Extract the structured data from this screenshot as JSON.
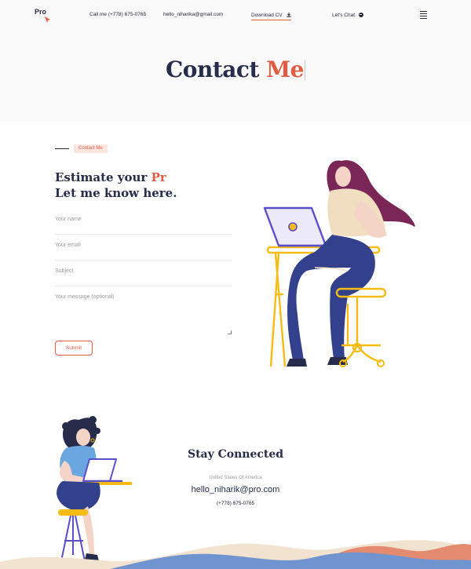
{
  "header": {
    "logo": "Pro",
    "phone": "Call me (+778) 675-0765",
    "email": "hello_niharika@gmail.com",
    "download_cv": "Download CV",
    "lets_chat": "Let's Chat"
  },
  "hero": {
    "title_main": "Contact",
    "title_accent": "Me"
  },
  "contact": {
    "eyebrow": "Contact Me",
    "heading_line1": "Estimate your",
    "heading_accent": "Pr",
    "heading_line2": "Let me know here.",
    "name_placeholder": "Your name",
    "email_placeholder": "Your email",
    "subject_placeholder": "Subject",
    "message_placeholder": "Your message (optional)",
    "submit_label": "Submit"
  },
  "stay_connected": {
    "title": "Stay Connected",
    "country": "United States Of America",
    "email": "hello_niharik@pro.com",
    "phone": "(+778) 675-0765"
  },
  "colors": {
    "accent": "#e05d44",
    "navy": "#272c4a",
    "hero_bg": "#f9f9f9"
  }
}
